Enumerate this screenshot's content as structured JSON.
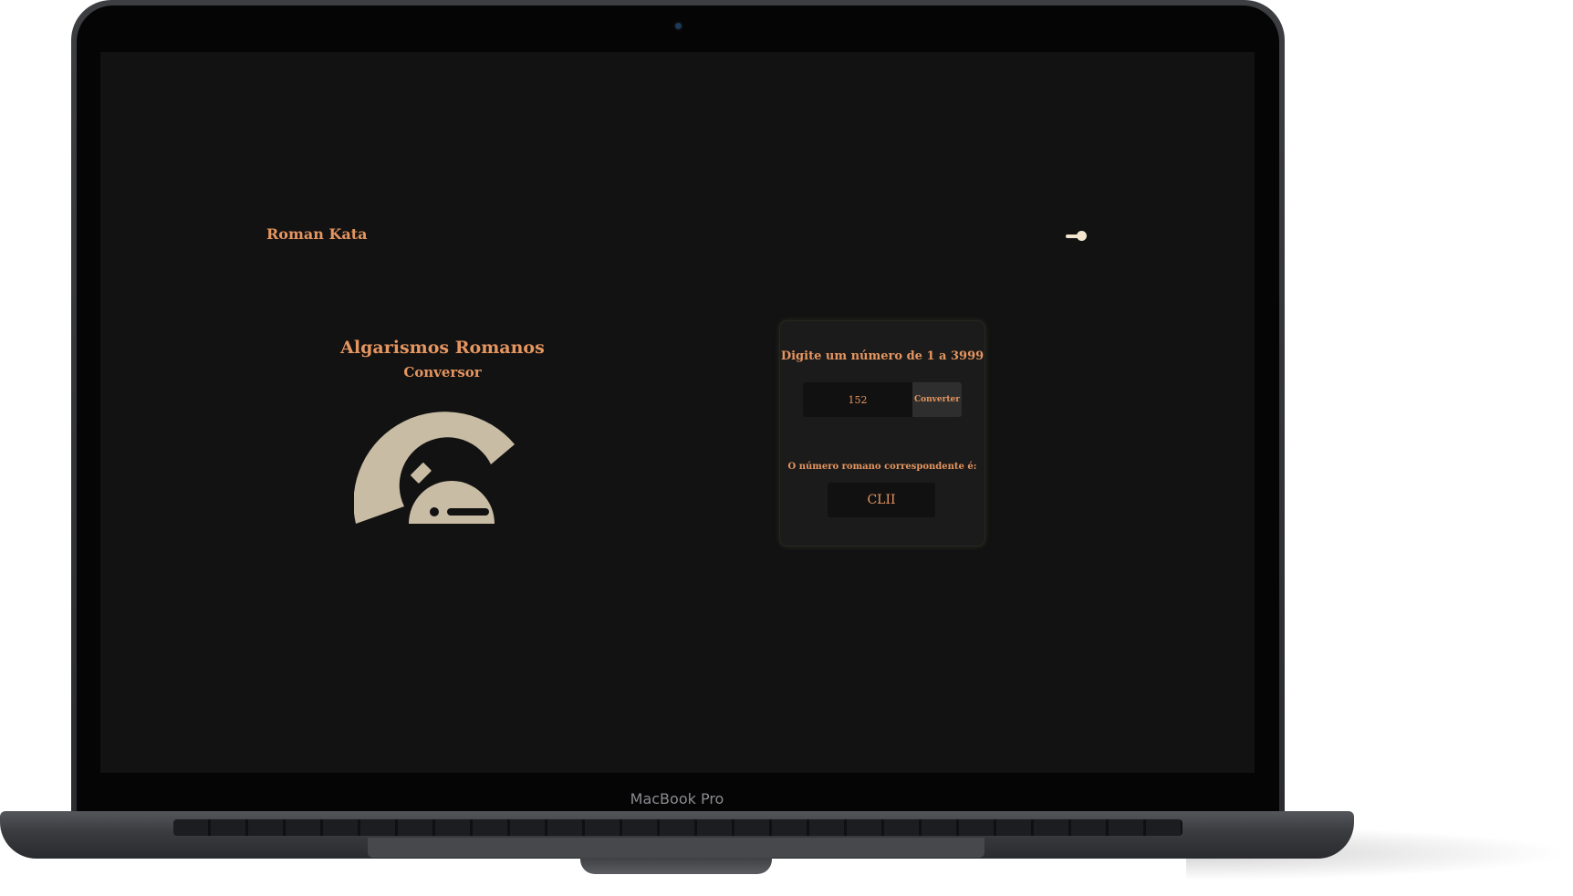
{
  "device": {
    "model_label": "MacBook Pro"
  },
  "app": {
    "title": "Roman Kata",
    "theme_toggle_icon": "toggle-switch-icon"
  },
  "hero": {
    "title": "Algarismos Romanos",
    "subtitle": "Conversor",
    "illustration_icon": "roman-helmet-icon",
    "illustration_color": "#c8bca4"
  },
  "converter": {
    "heading": "Digite um número de 1 a 3999",
    "input_value": "152",
    "button_label": "Converter",
    "result_label": "O número romano correspondente é:",
    "result_value": "CLII"
  },
  "colors": {
    "accent": "#e5955f",
    "background": "#121212",
    "card": "#1b1b1b"
  }
}
